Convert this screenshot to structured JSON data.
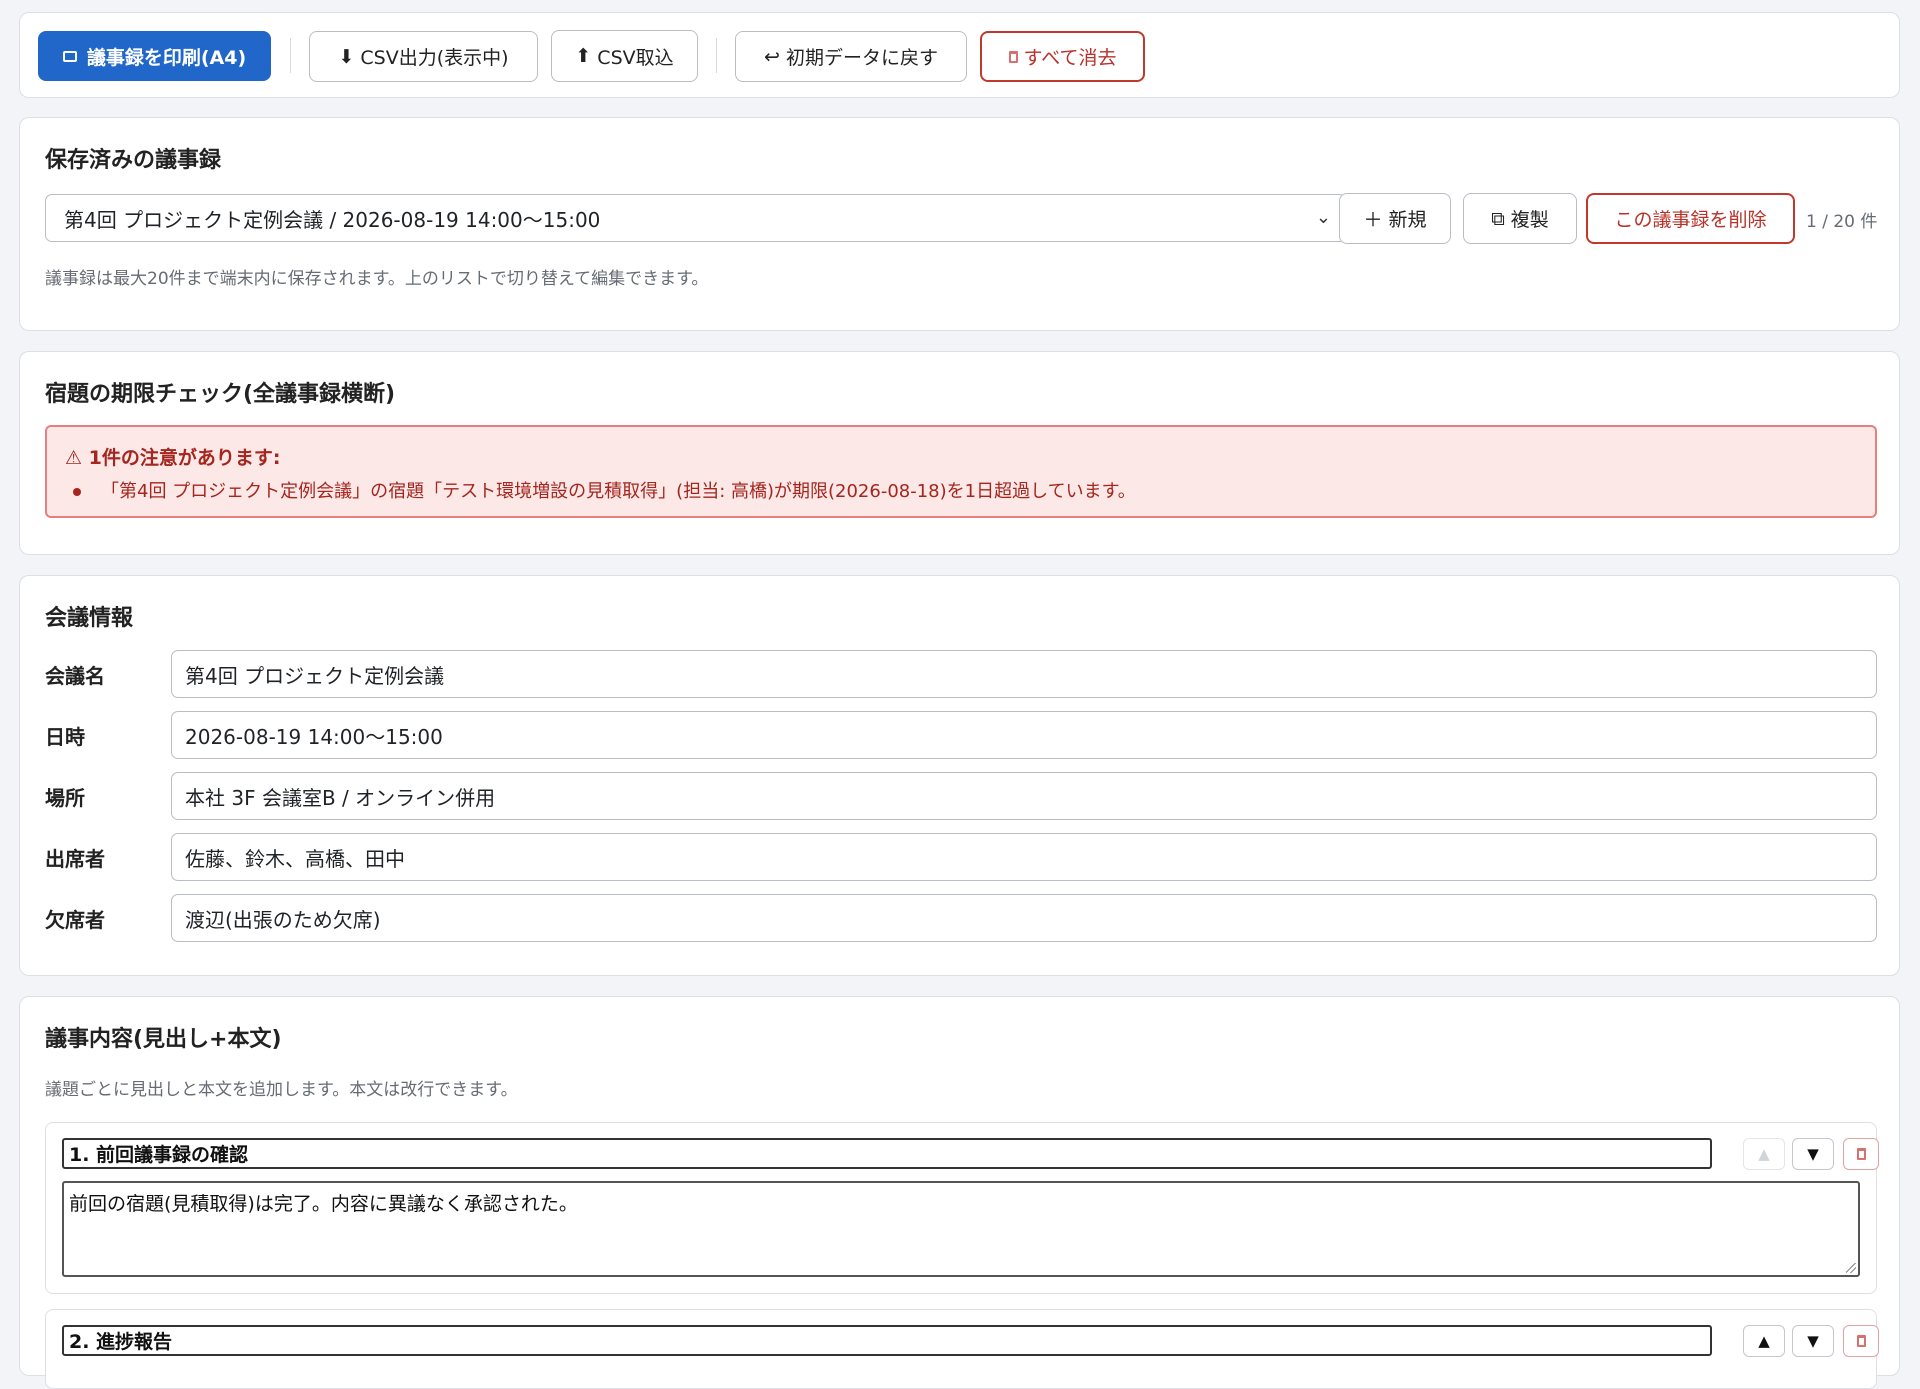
{
  "toolbar": {
    "print_label": "議事録を印刷(A4)",
    "csv_export_label": "CSV出力(表示中)",
    "csv_import_label": "CSV取込",
    "reset_label": "初期データに戻す",
    "clear_label": "すべて消去"
  },
  "saved": {
    "title": "保存済みの議事録",
    "selected": "第4回 プロジェクト定例会議 / 2026-08-19 14:00〜15:00",
    "new_label": "新規",
    "duplicate_label": "複製",
    "delete_label": "この議事録を削除",
    "count": "1 / 20 件",
    "hint": "議事録は最大20件まで端末内に保存されます。上のリストで切り替えて編集できます。"
  },
  "deadline": {
    "title": "宿題の期限チェック(全議事録横断)",
    "alert_title": "1件の注意があります:",
    "items": [
      "「第4回 プロジェクト定例会議」の宿題「テスト環境増設の見積取得」(担当: 高橋)が期限(2026-08-18)を1日超過しています。"
    ]
  },
  "meeting": {
    "title": "会議情報",
    "fields": [
      {
        "label": "会議名",
        "value": "第4回 プロジェクト定例会議"
      },
      {
        "label": "日時",
        "value": "2026-08-19 14:00〜15:00"
      },
      {
        "label": "場所",
        "value": "本社 3F 会議室B / オンライン併用"
      },
      {
        "label": "出席者",
        "value": "佐藤、鈴木、高橋、田中"
      },
      {
        "label": "欠席者",
        "value": "渡辺(出張のため欠席)"
      }
    ]
  },
  "agenda": {
    "title": "議事内容(見出し+本文)",
    "hint": "議題ごとに見出しと本文を追加します。本文は改行できます。",
    "items": [
      {
        "heading": "1. 前回議事録の確認",
        "body": "前回の宿題(見積取得)は完了。内容に異議なく承認された。"
      },
      {
        "heading": "2. 進捗報告",
        "body": ""
      }
    ]
  }
}
